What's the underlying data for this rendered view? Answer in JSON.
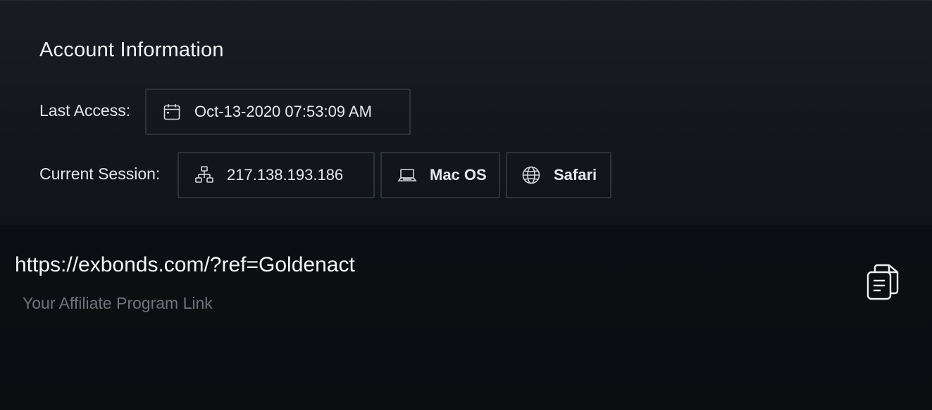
{
  "account": {
    "title": "Account Information",
    "last_access_label": "Last Access:",
    "last_access_value": "Oct-13-2020 07:53:09 AM",
    "current_session_label": "Current Session:",
    "session": {
      "ip": "217.138.193.186",
      "os": "Mac OS",
      "browser": "Safari"
    }
  },
  "affiliate": {
    "link": "https://exbonds.com/?ref=Goldenact",
    "caption": "Your Affiliate Program Link"
  },
  "icons": {
    "date": "calendar-icon",
    "ip": "network-icon",
    "os": "laptop-icon",
    "browser": "globe-icon",
    "copy": "copy-icon"
  },
  "colors": {
    "background": "#0a0c10",
    "chip_border": "#2e323a",
    "caption_text": "#6f737b"
  }
}
